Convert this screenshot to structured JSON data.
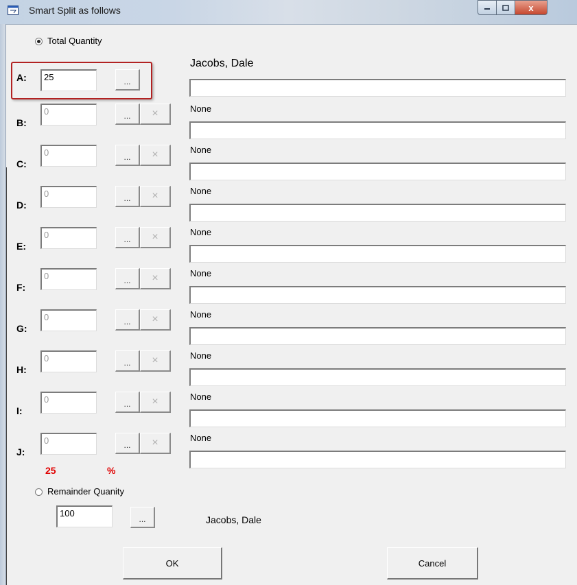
{
  "window": {
    "title": "Smart Split as follows",
    "close_glyph": "x",
    "min_glyph": "▁",
    "max_glyph": "□"
  },
  "total_quantity": {
    "label": "Total Quantity",
    "selected": true
  },
  "rows": [
    {
      "letter": "A:",
      "qty": "25",
      "name": "Jacobs, Dale",
      "dots": "...",
      "x": ""
    },
    {
      "letter": "B:",
      "qty": "0",
      "name": "None",
      "dots": "...",
      "x": "×"
    },
    {
      "letter": "C:",
      "qty": "0",
      "name": "None",
      "dots": "...",
      "x": "×"
    },
    {
      "letter": "D:",
      "qty": "0",
      "name": "None",
      "dots": "...",
      "x": "×"
    },
    {
      "letter": "E:",
      "qty": "0",
      "name": "None",
      "dots": "...",
      "x": "×"
    },
    {
      "letter": "F:",
      "qty": "0",
      "name": "None",
      "dots": "...",
      "x": "×"
    },
    {
      "letter": "G:",
      "qty": "0",
      "name": "None",
      "dots": "...",
      "x": "×"
    },
    {
      "letter": "H:",
      "qty": "0",
      "name": "None",
      "dots": "...",
      "x": "×"
    },
    {
      "letter": "I:",
      "qty": "0",
      "name": "None",
      "dots": "...",
      "x": "×"
    },
    {
      "letter": "J:",
      "qty": "0",
      "name": "None",
      "dots": "...",
      "x": "×"
    }
  ],
  "total_value": "25",
  "percent_symbol": "%",
  "remainder": {
    "label": "Remainder Quanity",
    "selected": false,
    "qty": "100",
    "dots": "...",
    "name": "Jacobs, Dale"
  },
  "buttons": {
    "ok": "OK",
    "cancel": "Cancel"
  },
  "colors": {
    "accent_red": "#e00000",
    "highlight_border": "#b22222"
  }
}
